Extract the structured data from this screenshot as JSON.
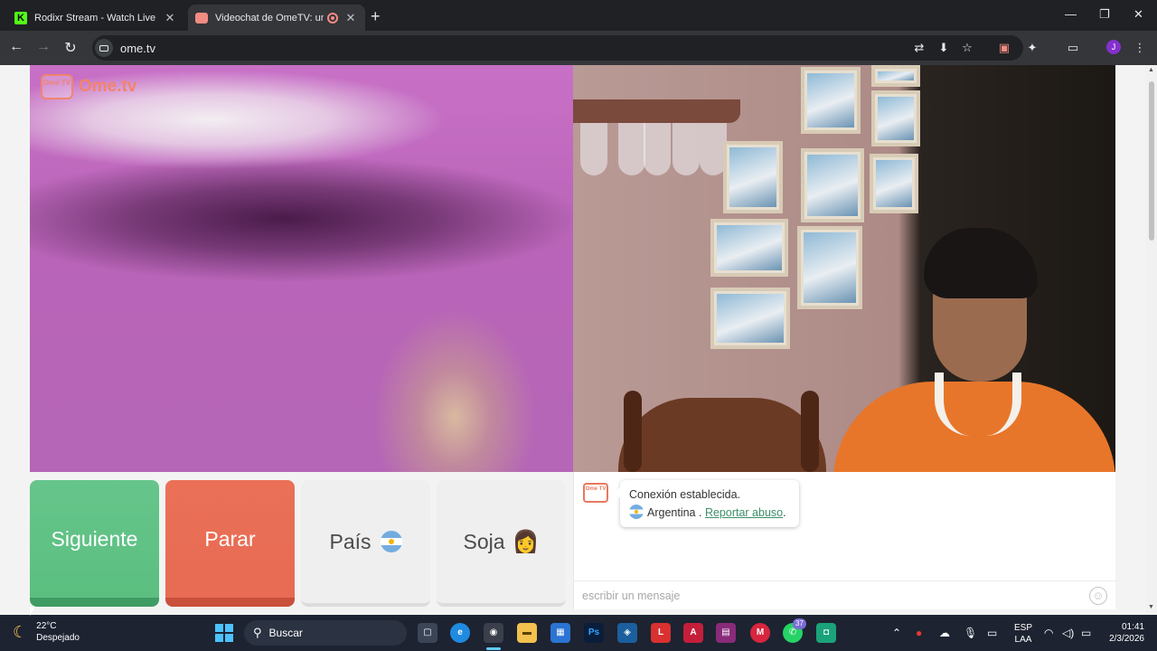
{
  "browser": {
    "tabs": [
      {
        "title": "Rodixr Stream - Watch Live on Kick",
        "close": "✕"
      },
      {
        "title": "Videochat de OmeTV: una alternativa",
        "close": "✕"
      }
    ],
    "new_tab": "+",
    "window_controls": {
      "minimize": "—",
      "maximize": "❐",
      "close": "✕"
    },
    "url": "ome.tv",
    "profile_initial": "J"
  },
  "page": {
    "logo": {
      "badge": "Ome TV",
      "text": "Ome.tv"
    },
    "buttons": {
      "next": "Siguiente",
      "stop": "Parar",
      "country": "País",
      "gender": "Soja",
      "gender_emoji": "👩"
    },
    "chat": {
      "icon_text": "Ome TV",
      "connection_text": "Conexión establecida.",
      "country": "Argentina",
      "separator": " . ",
      "report_link": "Reportar abuso",
      "report_suffix": ".",
      "input_placeholder": "escribir un mensaje",
      "emoji_button": "☺"
    }
  },
  "taskbar": {
    "weather_temp": "22°C",
    "weather_desc": "Despejado",
    "search_placeholder": "Buscar",
    "whatsapp_badge": "37",
    "language_line1": "ESP",
    "language_line2": "LAA",
    "time": "01:41",
    "date": "2/3/2026"
  },
  "colors": {
    "next_button": "#5bbf80",
    "stop_button": "#e86b53",
    "accent_link": "#3d8f6a",
    "chrome_bg": "#202124",
    "taskbar_bg": "#1d2331"
  }
}
